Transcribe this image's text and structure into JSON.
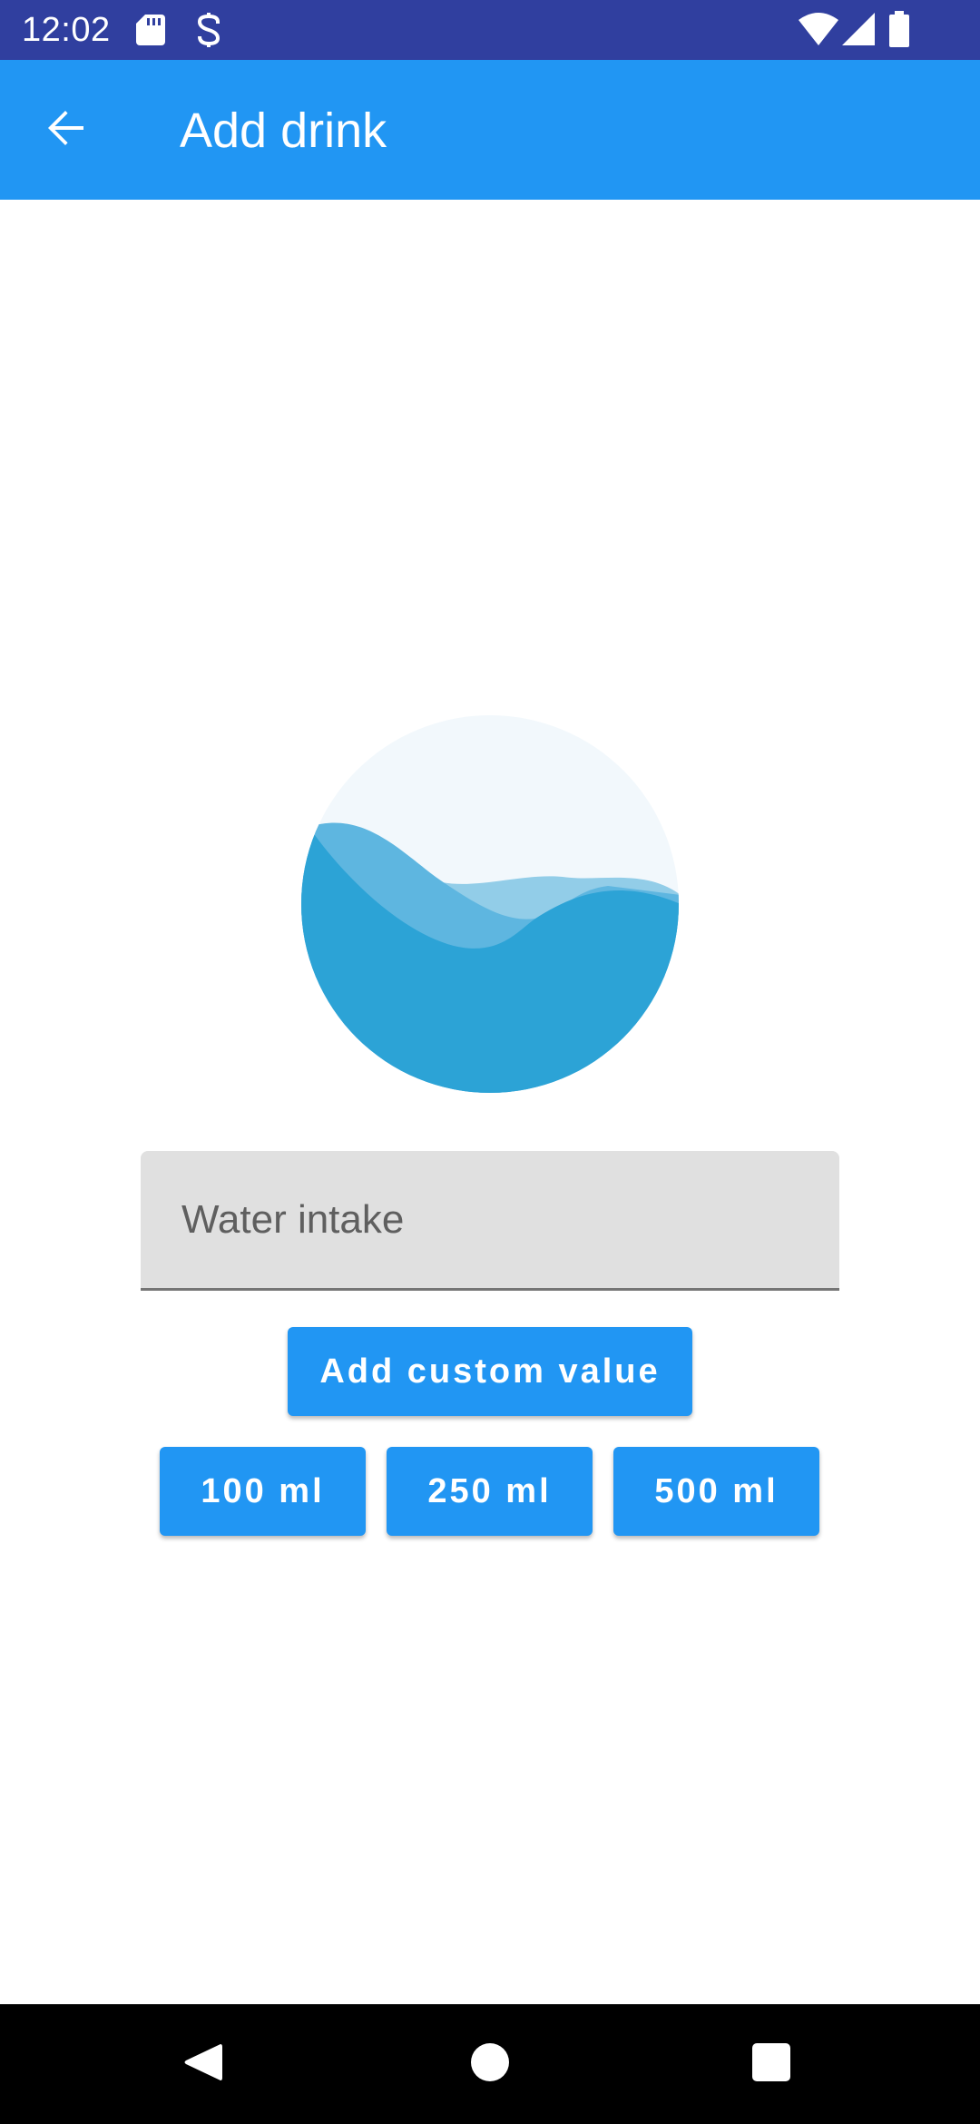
{
  "status_bar": {
    "time": "12:02",
    "icons": [
      "sd-card-icon",
      "data-saver-icon",
      "wifi-icon",
      "signal-icon",
      "battery-icon"
    ],
    "background": "#303F9F"
  },
  "app_bar": {
    "title": "Add drink",
    "back_icon": "arrow-back-icon",
    "background": "#2196F3"
  },
  "illustration": {
    "icon": "water-wave-icon",
    "colors": {
      "circle": "#F2F8FC",
      "wave_light": "#92CDE8",
      "wave_mid": "#5EB6E0",
      "wave_dark": "#2CA3D6"
    }
  },
  "input": {
    "placeholder": "Water intake",
    "value": ""
  },
  "buttons": {
    "custom_label": "Add custom value",
    "presets": [
      "100 ml",
      "250 ml",
      "500 ml"
    ],
    "color": "#2196F3"
  },
  "nav_bar": {
    "icons": [
      "nav-back-icon",
      "nav-home-icon",
      "nav-recents-icon"
    ]
  }
}
